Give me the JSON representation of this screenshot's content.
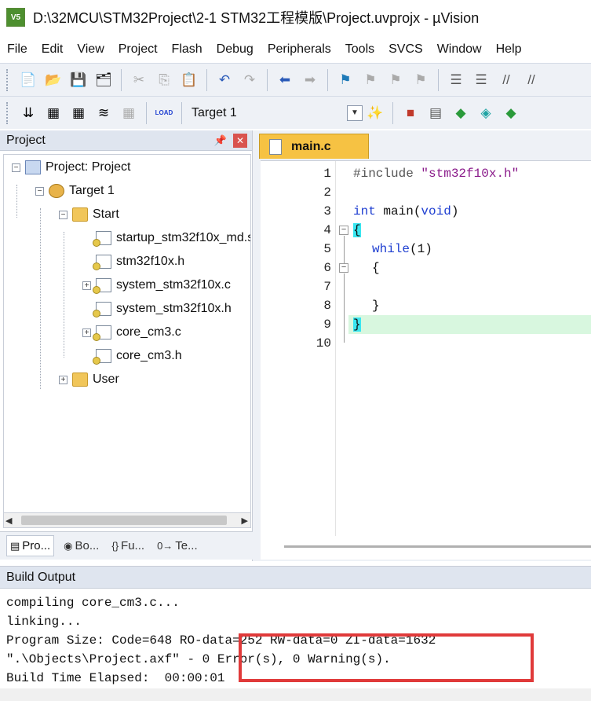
{
  "window": {
    "title": "D:\\32MCU\\STM32Project\\2-1 STM32工程模版\\Project.uvprojx - µVision",
    "app_icon_label": "V5"
  },
  "menu": [
    "File",
    "Edit",
    "View",
    "Project",
    "Flash",
    "Debug",
    "Peripherals",
    "Tools",
    "SVCS",
    "Window",
    "Help"
  ],
  "toolbar": {
    "target_name": "Target 1",
    "load_label": "LOAD"
  },
  "project_panel": {
    "title": "Project",
    "tree": [
      {
        "label": "Project: Project",
        "expander": "−"
      },
      {
        "label": "Target 1",
        "expander": "−"
      },
      {
        "label": "Start",
        "expander": "−"
      },
      {
        "label": "startup_stm32f10x_md.s",
        "expander": ""
      },
      {
        "label": "stm32f10x.h",
        "expander": ""
      },
      {
        "label": "system_stm32f10x.c",
        "expander": "+"
      },
      {
        "label": "system_stm32f10x.h",
        "expander": ""
      },
      {
        "label": "core_cm3.c",
        "expander": "+"
      },
      {
        "label": "core_cm3.h",
        "expander": ""
      },
      {
        "label": "User",
        "expander": "+"
      }
    ],
    "tabs": [
      "Pro...",
      "Bo...",
      "Fu...",
      "Te..."
    ]
  },
  "editor": {
    "tab_label": "main.c",
    "line_numbers": [
      "1",
      "2",
      "3",
      "4",
      "5",
      "6",
      "7",
      "8",
      "9",
      "10"
    ],
    "code": {
      "l1_pp": "#include ",
      "l1_str": "\"stm32f10x.h\"",
      "l3_kw1": "int",
      "l3_mid": " main(",
      "l3_kw2": "void",
      "l3_end": ")",
      "l4": "{",
      "l5_kw": "while",
      "l5_rest": "(1)",
      "l6": "{",
      "l8": "}",
      "l9": "}"
    }
  },
  "build_output": {
    "title": "Build Output",
    "lines": [
      "compiling core_cm3.c...",
      "linking...",
      "Program Size: Code=648 RO-data=252 RW-data=0 ZI-data=1632",
      "\".\\Objects\\Project.axf\" - 0 Error(s), 0 Warning(s).",
      "Build Time Elapsed:  00:00:01"
    ]
  },
  "colors": {
    "highlight_box": "#e03a3a",
    "editor_tab": "#f6c243",
    "keyword": "#1f3fd1",
    "string": "#8a1a8a",
    "brace_highlight": "#39e6f0"
  }
}
